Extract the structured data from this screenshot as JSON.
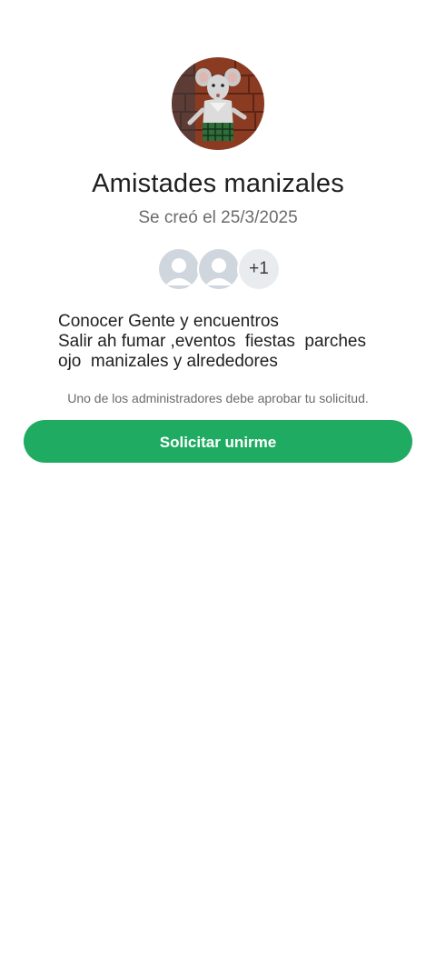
{
  "group": {
    "name": "Amistades manizales",
    "created": "Se creó el 25/3/2025",
    "description": "Conocer Gente y encuentros\nSalir ah fumar ,eventos  fiestas  parches\nojo  manizales y alrededores"
  },
  "members": {
    "extra_count": "+1"
  },
  "join": {
    "note": "Uno de los administradores debe aprobar tu solicitud.",
    "button_label": "Solicitar unirme"
  },
  "colors": {
    "accent": "#1fab62",
    "placeholder_avatar": "#cfd6dd"
  },
  "icons": {
    "member_placeholder": "person-placeholder-icon"
  }
}
